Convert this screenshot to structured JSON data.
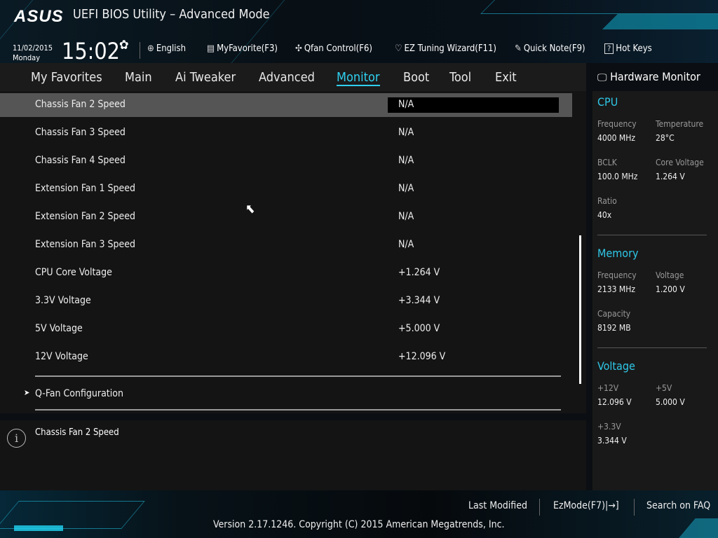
{
  "header": {
    "logo": "ASUS",
    "title": "UEFI BIOS Utility – Advanced Mode",
    "date": "11/02/2015",
    "day": "Monday",
    "time": "15:02"
  },
  "toolbar": [
    {
      "icon": "globe-icon",
      "glyph": "🌐",
      "label": "English"
    },
    {
      "icon": "favorite-icon",
      "glyph": "▤",
      "label": "MyFavorite(F3)"
    },
    {
      "icon": "fan-icon",
      "glyph": "✣",
      "label": "Qfan Control(F6)"
    },
    {
      "icon": "bulb-icon",
      "glyph": "♡",
      "label": "EZ Tuning Wizard(F11)"
    },
    {
      "icon": "note-icon",
      "glyph": "✎",
      "label": "Quick Note(F9)"
    },
    {
      "icon": "help-icon",
      "glyph": "?",
      "label": "Hot Keys"
    }
  ],
  "tabs": [
    "My Favorites",
    "Main",
    "Ai Tweaker",
    "Advanced",
    "Monitor",
    "Boot",
    "Tool",
    "Exit"
  ],
  "active_tab": "Monitor",
  "rows": [
    {
      "label": "Chassis Fan 2 Speed",
      "value": "N/A"
    },
    {
      "label": "Chassis Fan 3 Speed",
      "value": "N/A"
    },
    {
      "label": "Chassis Fan 4 Speed",
      "value": "N/A"
    },
    {
      "label": "Extension Fan 1 Speed",
      "value": "N/A"
    },
    {
      "label": "Extension Fan 2 Speed",
      "value": "N/A"
    },
    {
      "label": "Extension Fan 3 Speed",
      "value": "N/A"
    },
    {
      "label": "CPU Core Voltage",
      "value": "+1.264 V"
    },
    {
      "label": "3.3V Voltage",
      "value": "+3.344 V"
    },
    {
      "label": "5V Voltage",
      "value": "+5.000 V"
    },
    {
      "label": "12V Voltage",
      "value": "+12.096 V"
    }
  ],
  "submenu": "Q-Fan Configuration",
  "help_text": "Chassis Fan 2 Speed",
  "hw": {
    "title": "Hardware Monitor",
    "cpu": {
      "title": "CPU",
      "freq_k": "Frequency",
      "freq": "4000 MHz",
      "temp_k": "Temperature",
      "temp": "28°C",
      "bclk_k": "BCLK",
      "bclk": "100.0 MHz",
      "cv_k": "Core Voltage",
      "cv": "1.264 V",
      "ratio_k": "Ratio",
      "ratio": "40x"
    },
    "mem": {
      "title": "Memory",
      "freq_k": "Frequency",
      "freq": "2133 MHz",
      "volt_k": "Voltage",
      "volt": "1.200 V",
      "cap_k": "Capacity",
      "cap": "8192 MB"
    },
    "volt": {
      "title": "Voltage",
      "v12_k": "+12V",
      "v12": "12.096 V",
      "v5_k": "+5V",
      "v5": "5.000 V",
      "v33_k": "+3.3V",
      "v33": "3.344 V"
    }
  },
  "footer": {
    "last_modified": "Last Modified",
    "ezmode": "EzMode(F7)|→]",
    "faq": "Search on FAQ",
    "copyright": "Version 2.17.1246. Copyright (C) 2015 American Megatrends, Inc."
  },
  "colors": {
    "accent": "#2fd0f0"
  }
}
